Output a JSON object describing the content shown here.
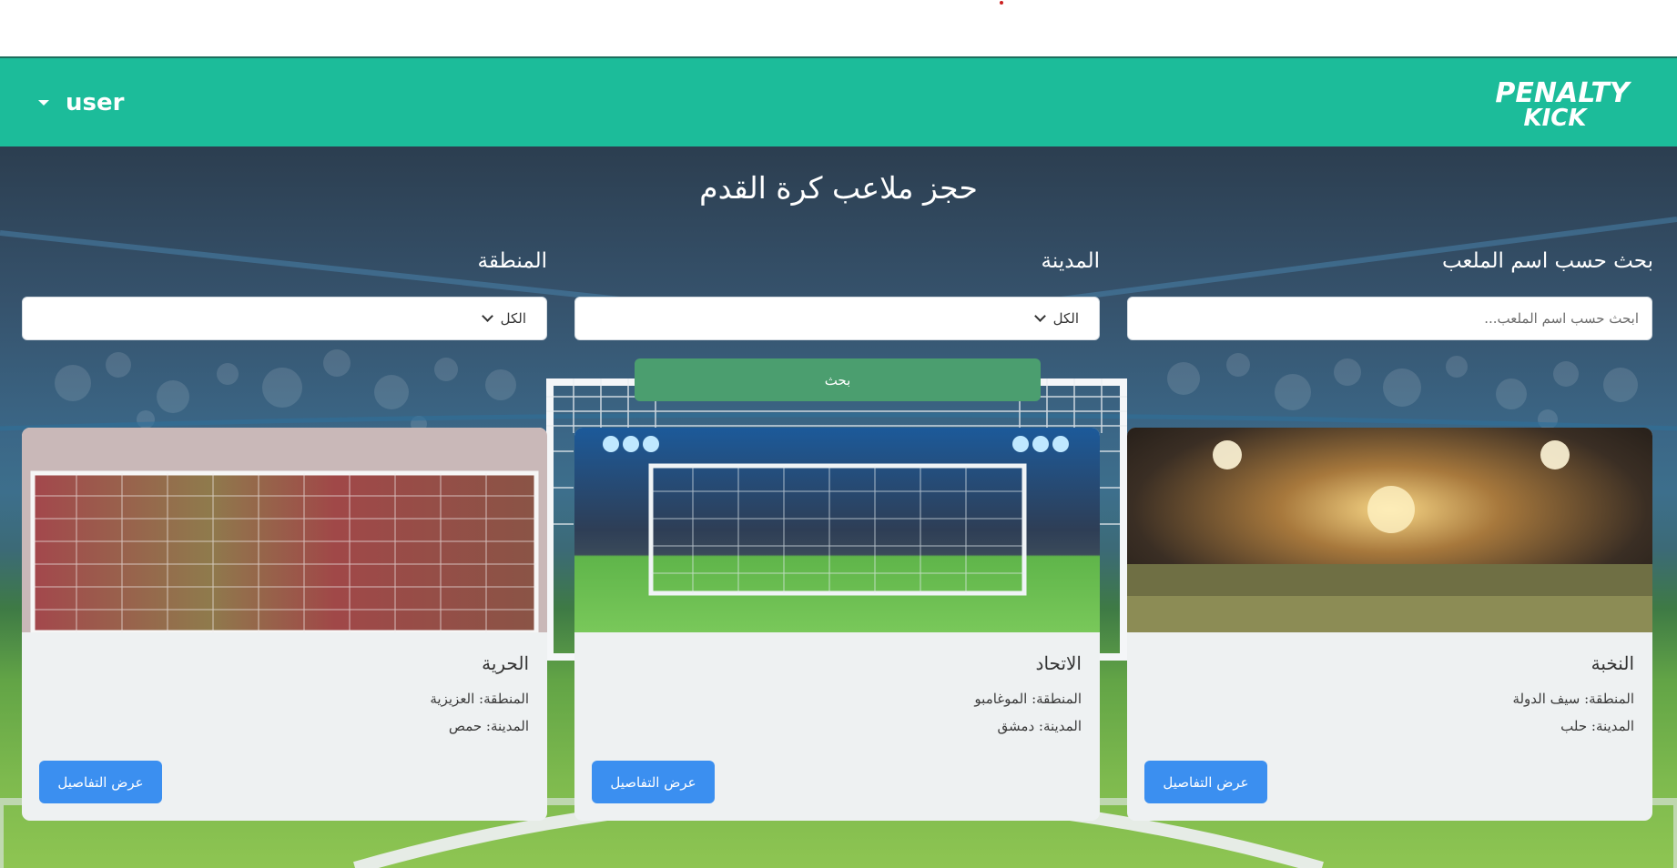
{
  "header": {
    "user_label": "user",
    "logo_line1": "PENALTY",
    "logo_line2": "KICK"
  },
  "page": {
    "title": "حجز ملاعب كرة القدم"
  },
  "filters": {
    "name_label": "بحث حسب اسم الملعب",
    "name_placeholder": "ابحث حسب اسم الملعب...",
    "city_label": "المدينة",
    "city_value": "الكل",
    "area_label": "المنطقة",
    "area_value": "الكل",
    "search_button": "بحث"
  },
  "cards": [
    {
      "title": "النخبة",
      "area": "المنطقة: سيف الدولة",
      "city": "المدينة: حلب",
      "button": "عرض التفاصيل"
    },
    {
      "title": "الاتحاد",
      "area": "المنطقة: الموغامبو",
      "city": "المدينة: دمشق",
      "button": "عرض التفاصيل"
    },
    {
      "title": "الحرية",
      "area": "المنطقة: العزيزية",
      "city": "المدينة: حمص",
      "button": "عرض التفاصيل"
    }
  ],
  "colors": {
    "navbar": "#1cbc9a",
    "search_button": "#4b9e6f",
    "card_button": "#3b8ff0"
  }
}
